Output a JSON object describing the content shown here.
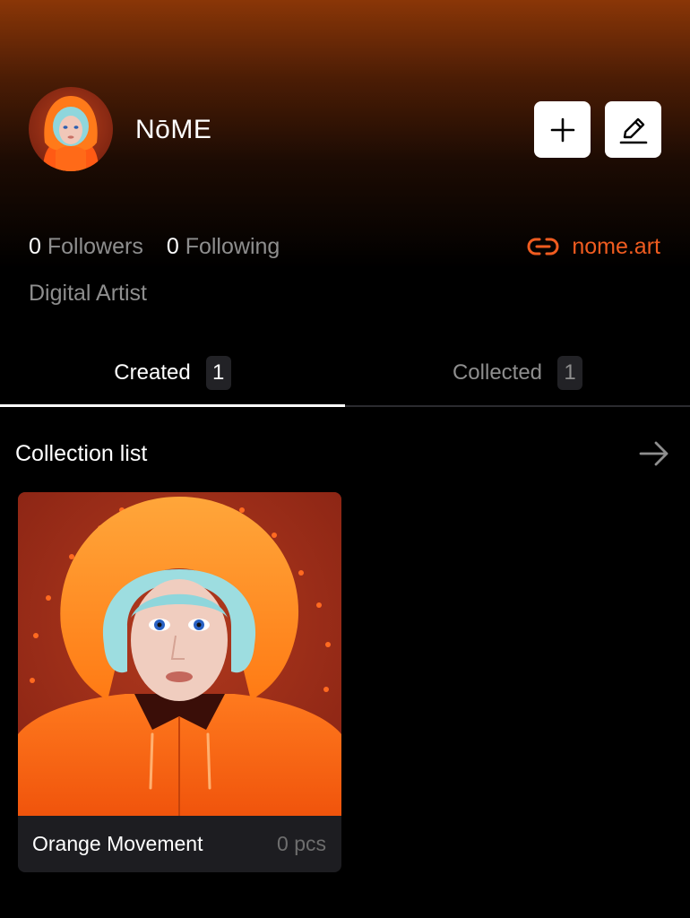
{
  "profile": {
    "name": "NōME",
    "followers_count": "0",
    "followers_label": "Followers",
    "following_count": "0",
    "following_label": "Following",
    "website": "nome.art",
    "bio": "Digital Artist"
  },
  "actions": {
    "add_icon": "plus-icon",
    "edit_icon": "pencil-icon"
  },
  "tabs": [
    {
      "label": "Created",
      "count": "1",
      "active": true
    },
    {
      "label": "Collected",
      "count": "1",
      "active": false
    }
  ],
  "section": {
    "title": "Collection list",
    "arrow_icon": "arrow-right-icon"
  },
  "collections": [
    {
      "name": "Orange Movement",
      "count": "0 pcs"
    }
  ],
  "colors": {
    "accent": "#f05c20",
    "background": "#000000",
    "header_gradient_top": "#8a3607",
    "muted_text": "#8e8e8e",
    "card_background": "#1d1d21"
  }
}
